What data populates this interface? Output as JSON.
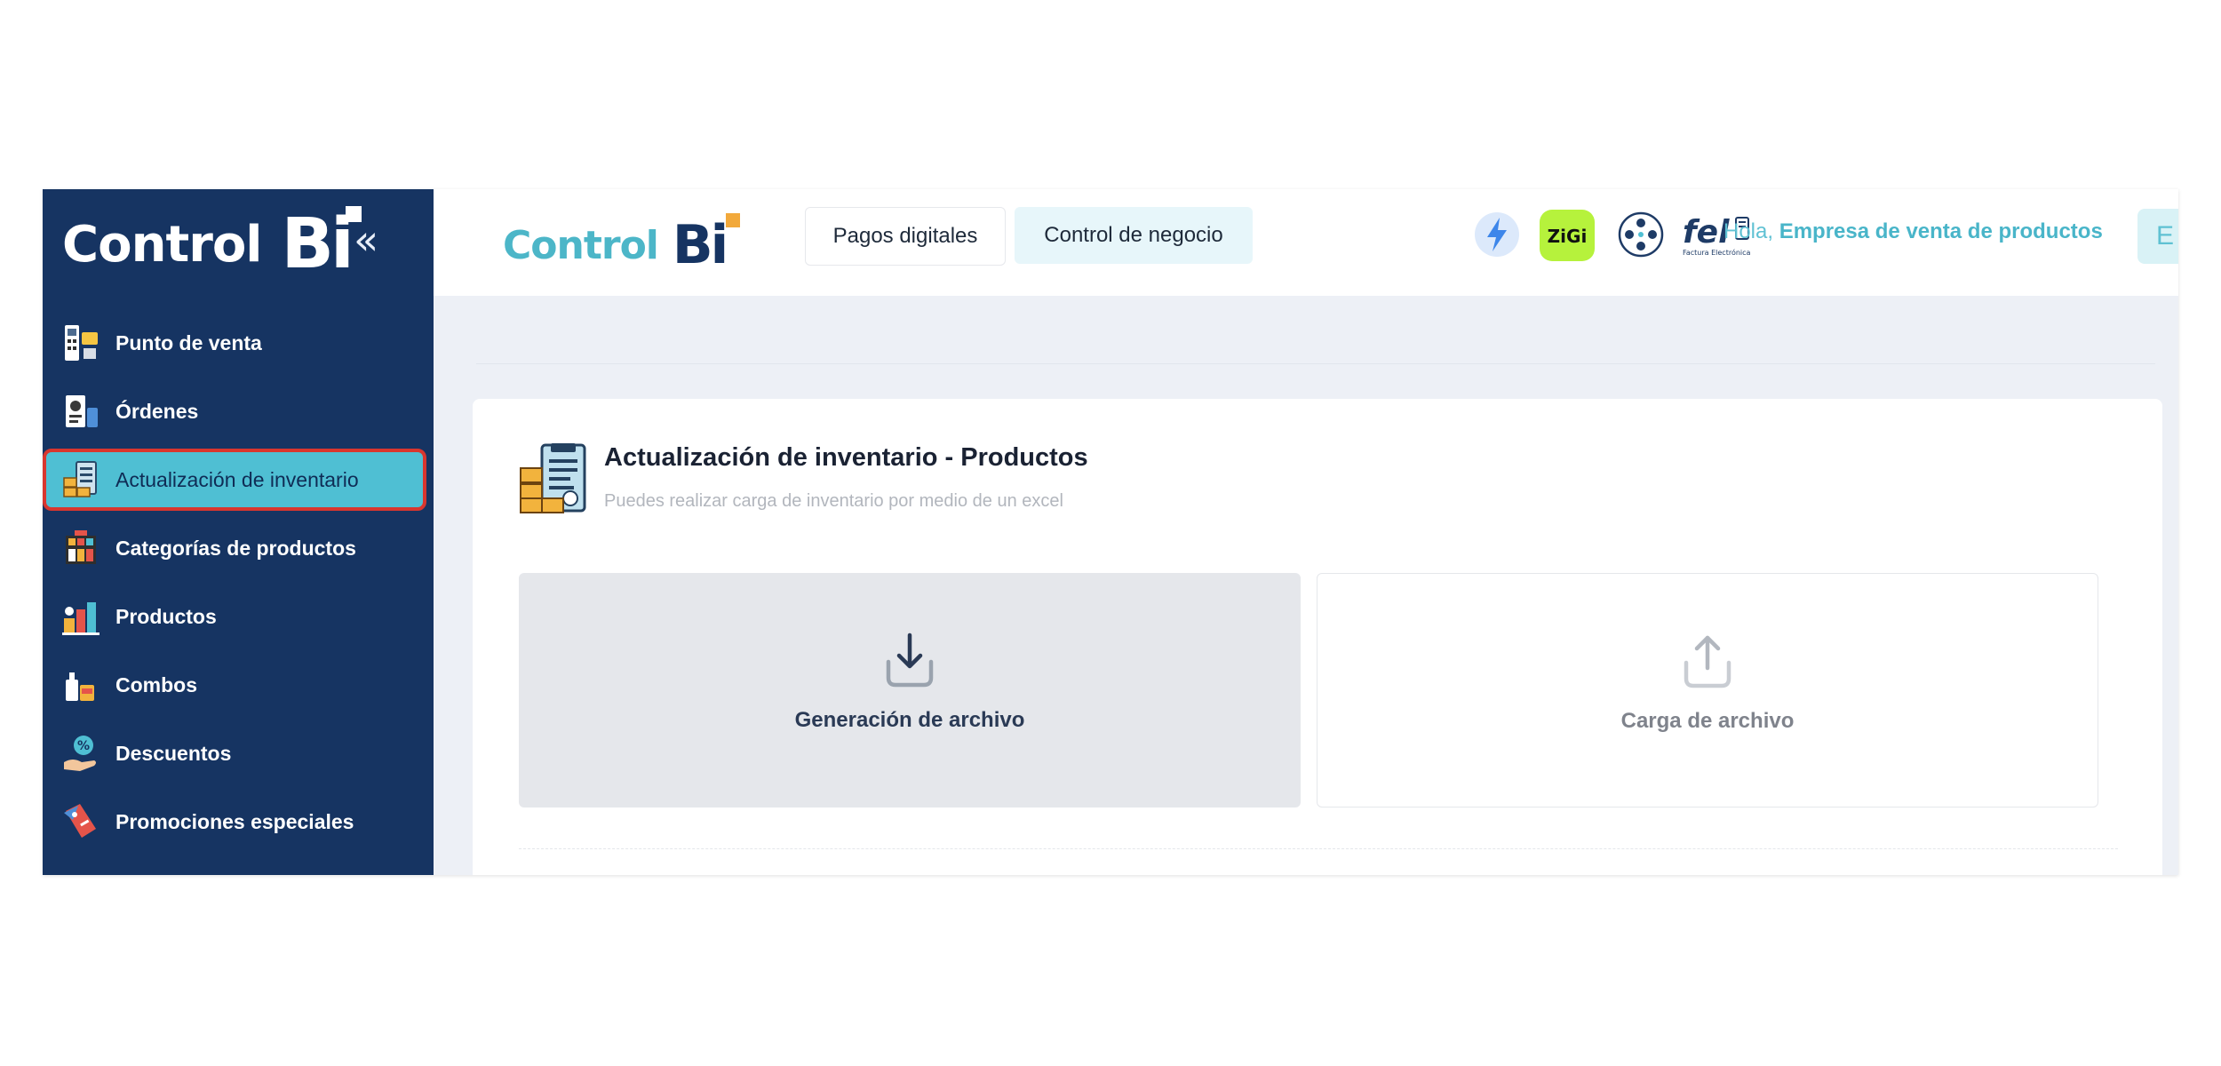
{
  "sidebar": {
    "brand_text": "Control",
    "brand_bi": "Bi",
    "collapse_glyph": "«",
    "items": [
      {
        "label": "Punto de venta",
        "icon": "pos-terminal-icon"
      },
      {
        "label": "Órdenes",
        "icon": "orders-icon"
      },
      {
        "label": "Actualización de inventario",
        "icon": "inventory-update-icon",
        "active": true
      },
      {
        "label": "Categorías de productos",
        "icon": "categories-icon"
      },
      {
        "label": "Productos",
        "icon": "products-icon"
      },
      {
        "label": "Combos",
        "icon": "combos-icon"
      },
      {
        "label": "Descuentos",
        "icon": "discounts-icon"
      },
      {
        "label": "Promociones especiales",
        "icon": "promotions-icon"
      }
    ]
  },
  "topbar": {
    "logo_text": "Control",
    "logo_bi": "Bi",
    "tabs": [
      {
        "label": "Pagos digitales"
      },
      {
        "label": "Control de negocio",
        "active": true
      }
    ],
    "integration_icons": [
      "lightning-icon",
      "zigi-logo-icon",
      "network-icon",
      "fel-logo-icon"
    ],
    "zigi_label": "ZiGi",
    "fel_label": "fel",
    "fel_caption": "Factura Electrónica",
    "greeting_prefix": "Hola,",
    "company_name": "Empresa de venta de productos",
    "avatar_initial": "E"
  },
  "main": {
    "title": "Actualización de inventario - Productos",
    "subtitle": "Puedes realizar carga de inventario por medio de un excel",
    "options": [
      {
        "label": "Generación de archivo",
        "icon": "download-icon",
        "selected": true
      },
      {
        "label": "Carga de archivo",
        "icon": "upload-icon"
      }
    ]
  },
  "colors": {
    "sidebar_bg": "#163462",
    "active_item_bg": "#4fbfd3",
    "active_item_border": "#d9362e",
    "accent_teal": "#4cb6c8",
    "logo_dot_orange": "#f2a93b",
    "zigi_green": "#b6f23c"
  }
}
